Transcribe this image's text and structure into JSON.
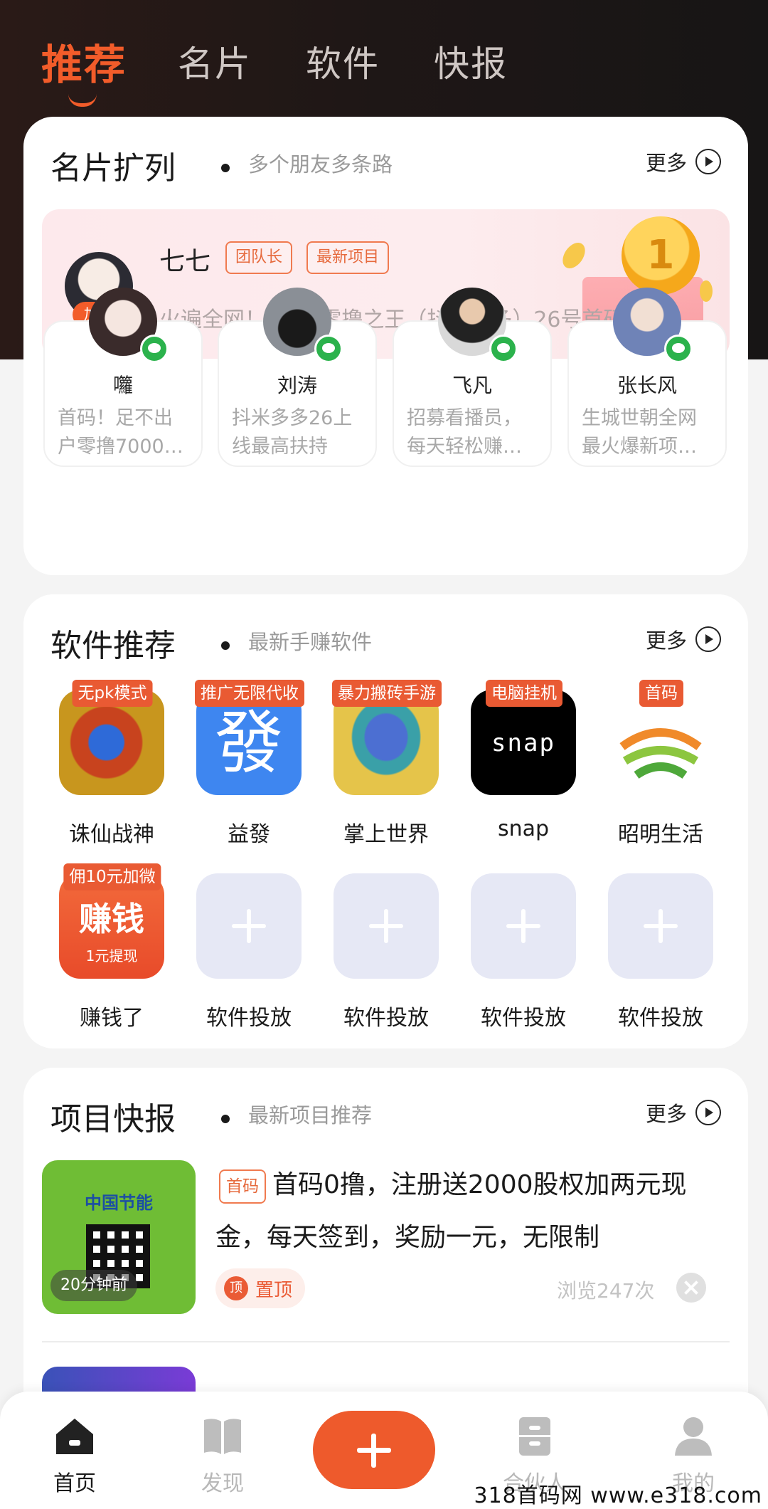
{
  "tabs": [
    {
      "label": "推荐"
    },
    {
      "label": "名片"
    },
    {
      "label": "软件"
    },
    {
      "label": "快报"
    }
  ],
  "card_section": {
    "title": "名片扩列",
    "subtitle": "多个朋友多条路",
    "more": "更多",
    "featured": {
      "name": "七七",
      "add_label": "加TA",
      "tags": [
        "团队长",
        "最新项目"
      ],
      "desc": "火遍全网！2023零撸之王（抖米多多）26号首码…",
      "coin_label": "1"
    },
    "friends": [
      {
        "name": "囖",
        "desc": "首码！足不出户零撸7000…"
      },
      {
        "name": "刘涛",
        "desc": "抖米多多26上线最高扶持"
      },
      {
        "name": "飞凡",
        "desc": "招募看播员，每天轻松赚…"
      },
      {
        "name": "张长风",
        "desc": "生城世朝全网最火爆新项…"
      }
    ]
  },
  "software_section": {
    "title": "软件推荐",
    "subtitle": "最新手赚软件",
    "more": "更多",
    "apps": [
      {
        "tag": "无pk模式",
        "label": "诛仙战神",
        "icon": "dragon-game-icon"
      },
      {
        "tag": "推广无限代收",
        "label": "益發",
        "icon": "fa-character-icon",
        "glyph": "發"
      },
      {
        "tag": "暴力搬砖手游",
        "label": "掌上世界",
        "icon": "egg-game-icon"
      },
      {
        "tag": "电脑挂机",
        "label": "snap",
        "icon": "snap-icon",
        "glyph": "snap"
      },
      {
        "tag": "首码",
        "label": "昭明生活",
        "icon": "sunrise-icon"
      },
      {
        "tag": "佣10元加微",
        "label": "赚钱了",
        "icon": "money-icon",
        "glyph": "赚钱",
        "sub_glyph": "1元提现"
      },
      {
        "label": "软件投放",
        "icon": "plus-icon"
      },
      {
        "label": "软件投放",
        "icon": "plus-icon"
      },
      {
        "label": "软件投放",
        "icon": "plus-icon"
      },
      {
        "label": "软件投放",
        "icon": "plus-icon"
      }
    ]
  },
  "news_section": {
    "title": "项目快报",
    "subtitle": "最新项目推荐",
    "more": "更多",
    "item": {
      "thumb_title": "中国节能",
      "time": "20分钟前",
      "tag": "首码",
      "title": "首码0撸，注册送2000股权加两元现金，每天签到，奖励一元，无限制",
      "pin_icon": "顶",
      "pin_label": "置顶",
      "views": "浏览247次"
    }
  },
  "bottom_nav": [
    {
      "label": "首页",
      "icon": "home-icon"
    },
    {
      "label": "发现",
      "icon": "book-icon"
    },
    {
      "label": "合伙人",
      "icon": "cabinet-icon"
    },
    {
      "label": "我的",
      "icon": "user-icon"
    }
  ],
  "watermark": "318首码网  www.e318.com",
  "colors": {
    "accent": "#f25c2a",
    "header_bg": "#1c1616",
    "card_bg": "#ffffff"
  }
}
